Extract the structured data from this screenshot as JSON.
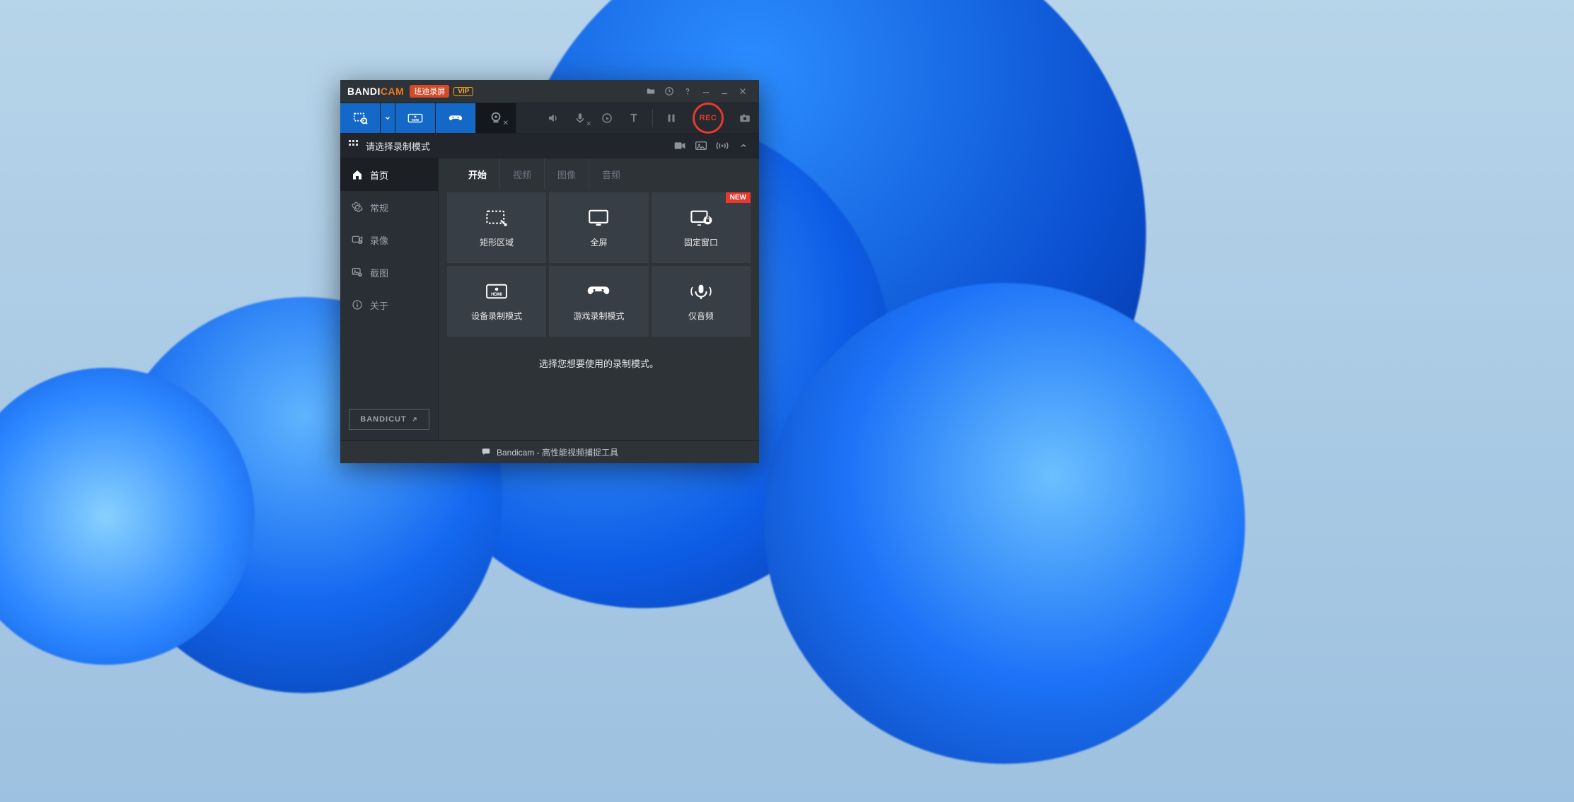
{
  "titlebar": {
    "logo_a": "BANDI",
    "logo_b": "CAM",
    "logo_sub": "班迪录屏",
    "vip": "VIP"
  },
  "modebar": {
    "rec": "REC"
  },
  "status": {
    "text": "请选择录制模式"
  },
  "sidebar": {
    "items": [
      {
        "label": "首页"
      },
      {
        "label": "常规"
      },
      {
        "label": "录像"
      },
      {
        "label": "截图"
      },
      {
        "label": "关于"
      }
    ],
    "bandicut": "BANDICUT"
  },
  "tabs": [
    {
      "label": "开始"
    },
    {
      "label": "视频"
    },
    {
      "label": "图像"
    },
    {
      "label": "音频"
    }
  ],
  "modes": [
    {
      "label": "矩形区域"
    },
    {
      "label": "全屏"
    },
    {
      "label": "固定窗口",
      "badge": "NEW"
    },
    {
      "label": "设备录制模式"
    },
    {
      "label": "游戏录制模式"
    },
    {
      "label": "仅音频"
    }
  ],
  "hint": "选择您想要使用的录制模式。",
  "footer": {
    "text": "Bandicam - 高性能视频捕捉工具"
  }
}
